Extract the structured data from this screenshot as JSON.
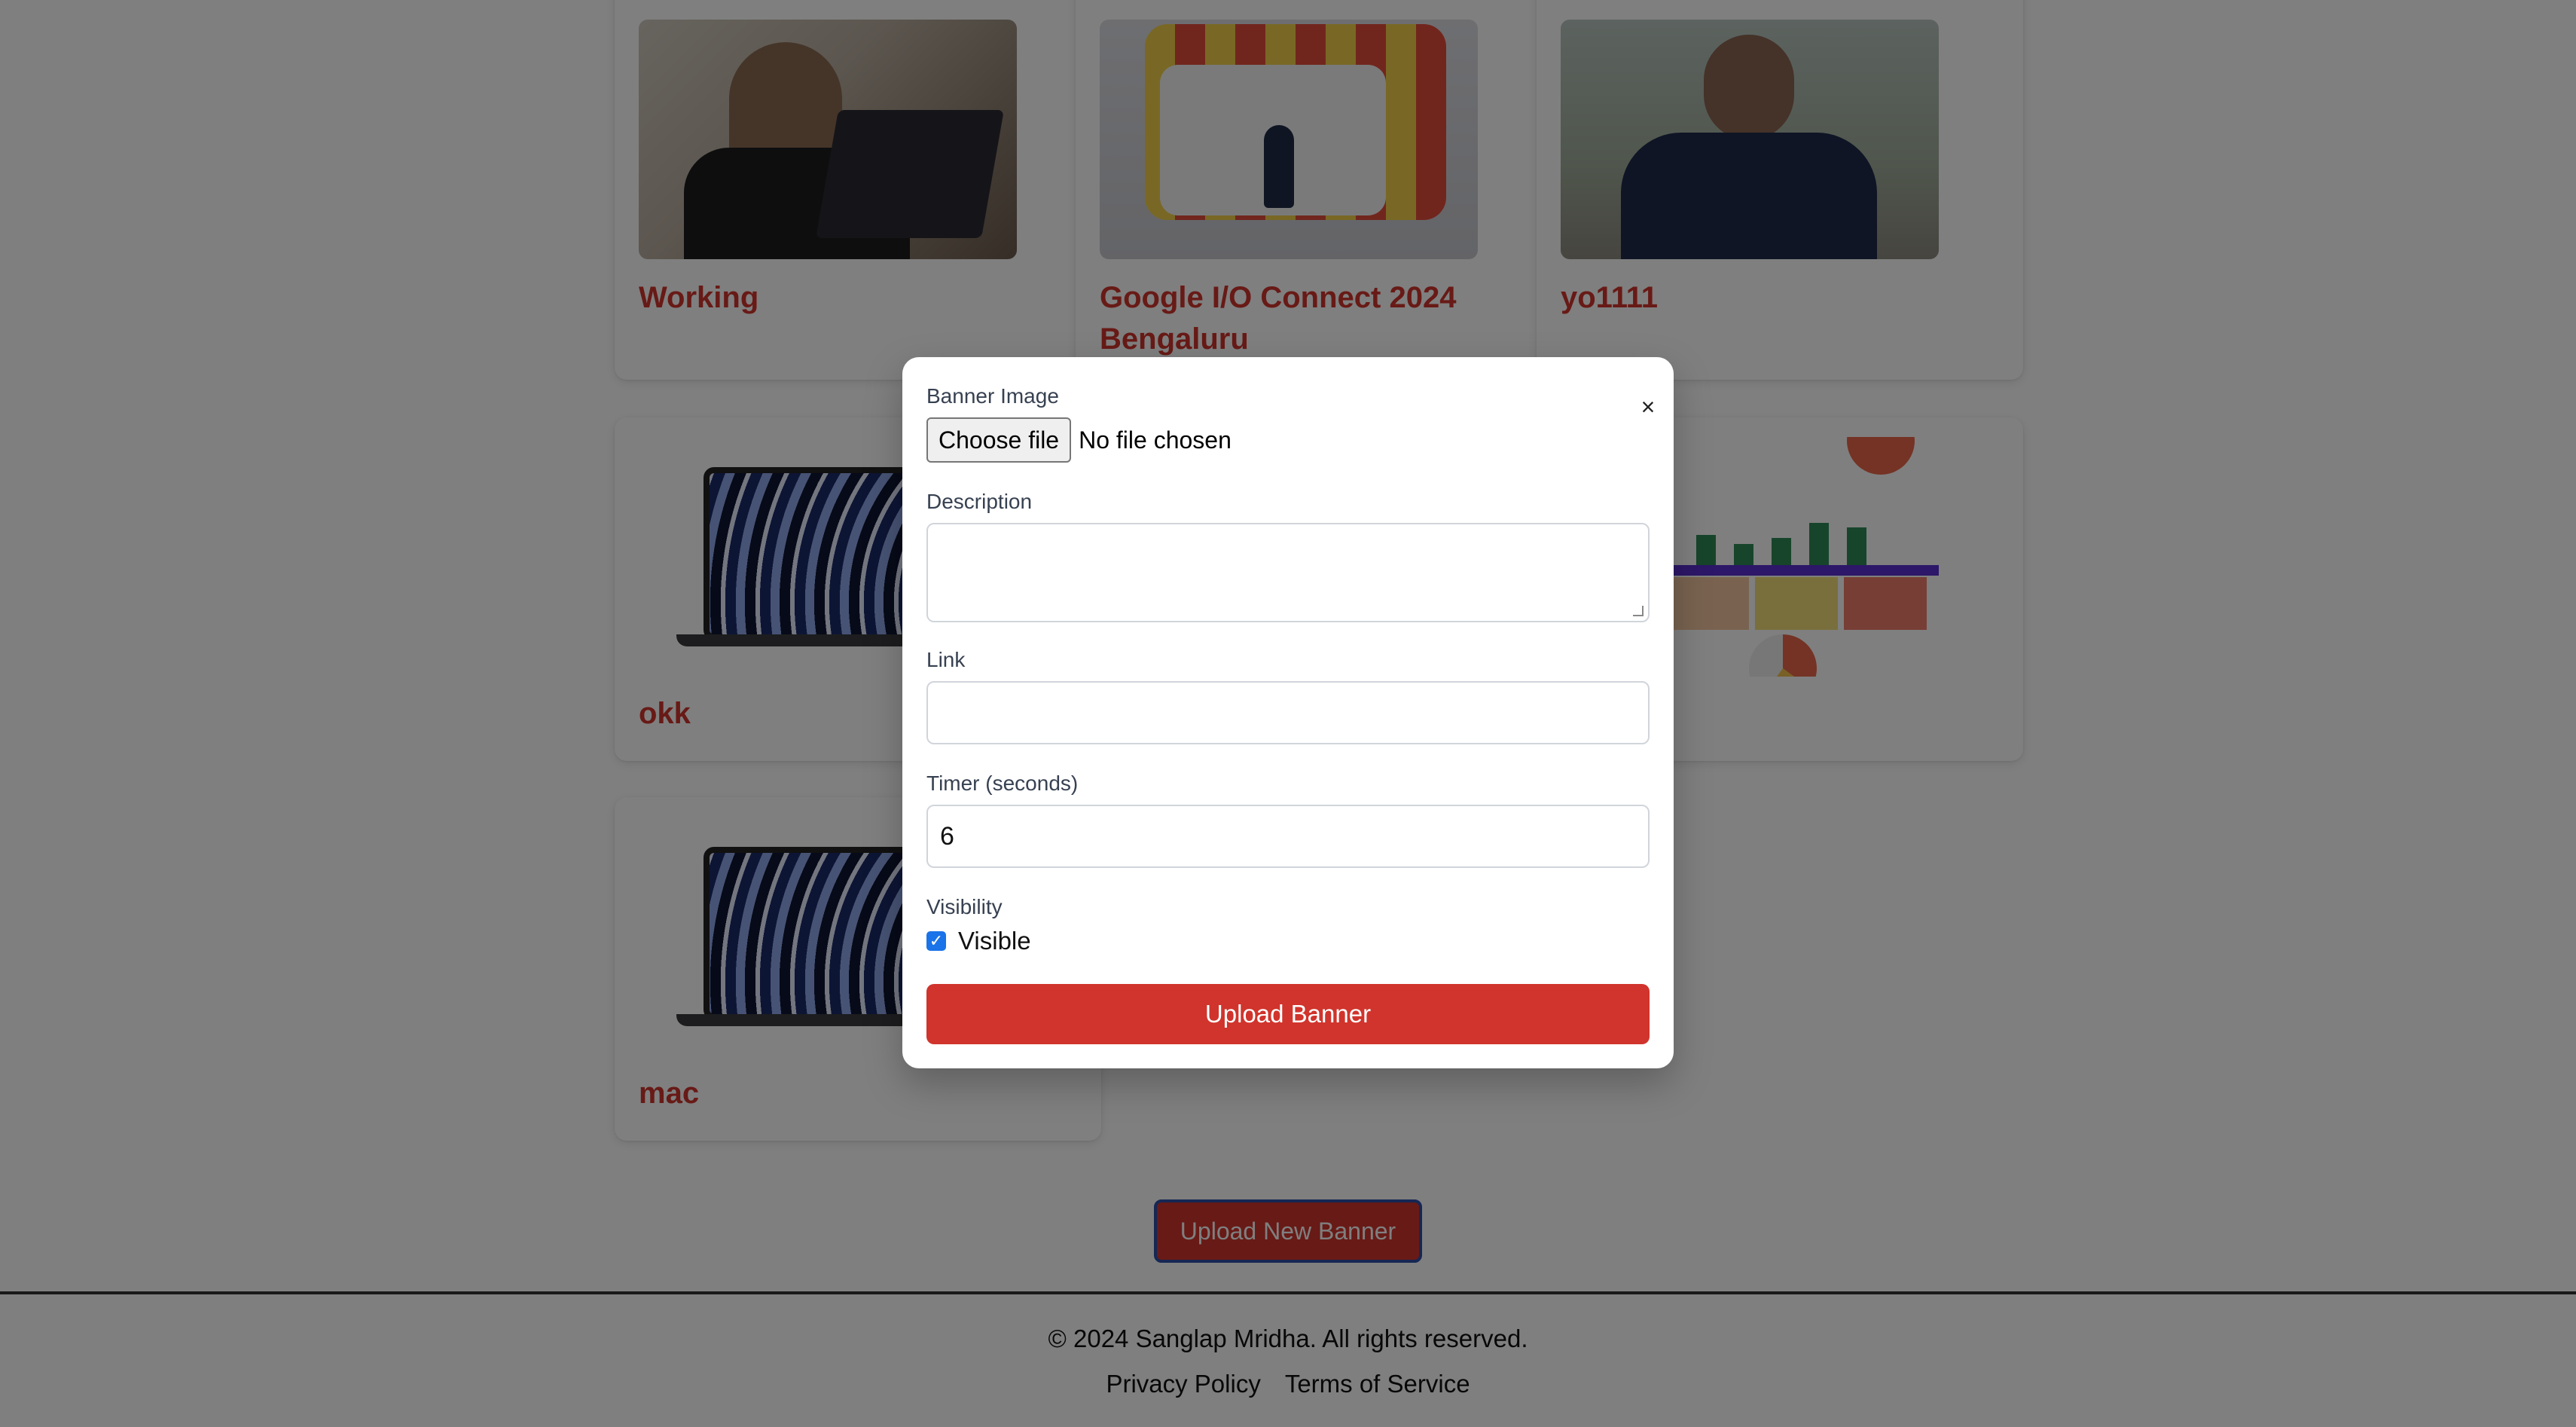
{
  "cards": [
    {
      "title": "Working",
      "image": "working-photo"
    },
    {
      "title": "Google I/O Connect 2024 Bengaluru",
      "image": "google-io-photo"
    },
    {
      "title": "yo1111",
      "image": "portrait-photo"
    },
    {
      "title": "okk",
      "image": "macbook-image"
    },
    {
      "title": "",
      "image": "dashboard-image"
    },
    {
      "title": "mac",
      "image": "macbook-image"
    }
  ],
  "page": {
    "upload_new_label": "Upload New Banner"
  },
  "footer": {
    "copyright": "© 2024 Sanglap Mridha. All rights reserved.",
    "privacy": "Privacy Policy",
    "terms": "Terms of Service"
  },
  "modal": {
    "close_glyph": "×",
    "banner_image_label": "Banner Image",
    "choose_file_label": "Choose file",
    "no_file_text": "No file chosen",
    "description_label": "Description",
    "description_value": "",
    "link_label": "Link",
    "link_value": "",
    "timer_label": "Timer (seconds)",
    "timer_value": "6",
    "visibility_label": "Visibility",
    "visible_label": "Visible",
    "visible_checked": true,
    "submit_label": "Upload Banner"
  },
  "colors": {
    "accent": "#d0342c",
    "checkbox": "#1a73e8",
    "overlay": "rgba(0,0,0,0.5)"
  }
}
